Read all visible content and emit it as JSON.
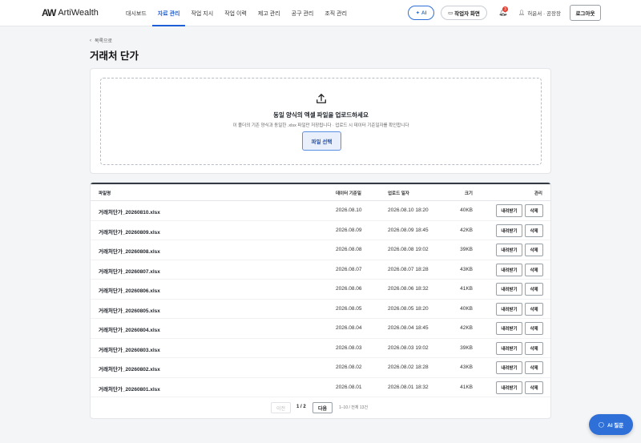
{
  "brand": {
    "name": "ArtiWealth",
    "mark": "AW"
  },
  "nav": [
    {
      "label": "대시보드",
      "active": false
    },
    {
      "label": "자료 관리",
      "active": true
    },
    {
      "label": "작업 지시",
      "active": false
    },
    {
      "label": "작업 이력",
      "active": false
    },
    {
      "label": "제고 관리",
      "active": false
    },
    {
      "label": "공구 관리",
      "active": false
    },
    {
      "label": "조직 관리",
      "active": false
    }
  ],
  "header": {
    "ai_label": "AI",
    "worker_label": "작업자 화면",
    "notif_count": "3",
    "user": "허윤서 · 공장장",
    "logout_label": "로그아웃"
  },
  "page": {
    "back_label": "목록으로",
    "title": "거래처 단가"
  },
  "upload": {
    "title": "동일 양식의 엑셀 파일을 업로드하세요",
    "subtitle": "이 폴더의 기존 양식과 동일한 .xlsx 파일만 저장됩니다 · 업로드 시 데이터 기준일자를 확인합니다",
    "button": "파일 선택"
  },
  "table": {
    "columns": {
      "name": "파일명",
      "date": "데이터 기준일",
      "uploaded": "업로드 일자",
      "size": "크기",
      "actions": "관리"
    },
    "download_label": "내려받기",
    "delete_label": "삭제",
    "rows": [
      {
        "name": "거래처단가_20260810.xlsx",
        "date": "2026.08.10",
        "uploaded": "2026.08.10 18:20",
        "size": "40KB"
      },
      {
        "name": "거래처단가_20260809.xlsx",
        "date": "2026.08.09",
        "uploaded": "2026.08.09 18:45",
        "size": "42KB"
      },
      {
        "name": "거래처단가_20260808.xlsx",
        "date": "2026.08.08",
        "uploaded": "2026.08.08 19:02",
        "size": "39KB"
      },
      {
        "name": "거래처단가_20260807.xlsx",
        "date": "2026.08.07",
        "uploaded": "2026.08.07 18:28",
        "size": "43KB"
      },
      {
        "name": "거래처단가_20260806.xlsx",
        "date": "2026.08.06",
        "uploaded": "2026.08.06 18:32",
        "size": "41KB"
      },
      {
        "name": "거래처단가_20260805.xlsx",
        "date": "2026.08.05",
        "uploaded": "2026.08.05 18:20",
        "size": "40KB"
      },
      {
        "name": "거래처단가_20260804.xlsx",
        "date": "2026.08.04",
        "uploaded": "2026.08.04 18:45",
        "size": "42KB"
      },
      {
        "name": "거래처단가_20260803.xlsx",
        "date": "2026.08.03",
        "uploaded": "2026.08.03 19:02",
        "size": "39KB"
      },
      {
        "name": "거래처단가_20260802.xlsx",
        "date": "2026.08.02",
        "uploaded": "2026.08.02 18:28",
        "size": "43KB"
      },
      {
        "name": "거래처단가_20260801.xlsx",
        "date": "2026.08.01",
        "uploaded": "2026.08.01 18:32",
        "size": "41KB"
      }
    ]
  },
  "pager": {
    "prev": "이전",
    "current": "1 / 2",
    "next": "다음",
    "info": "1–10 / 전체 13건"
  },
  "fab": {
    "label": "AI 질문"
  }
}
